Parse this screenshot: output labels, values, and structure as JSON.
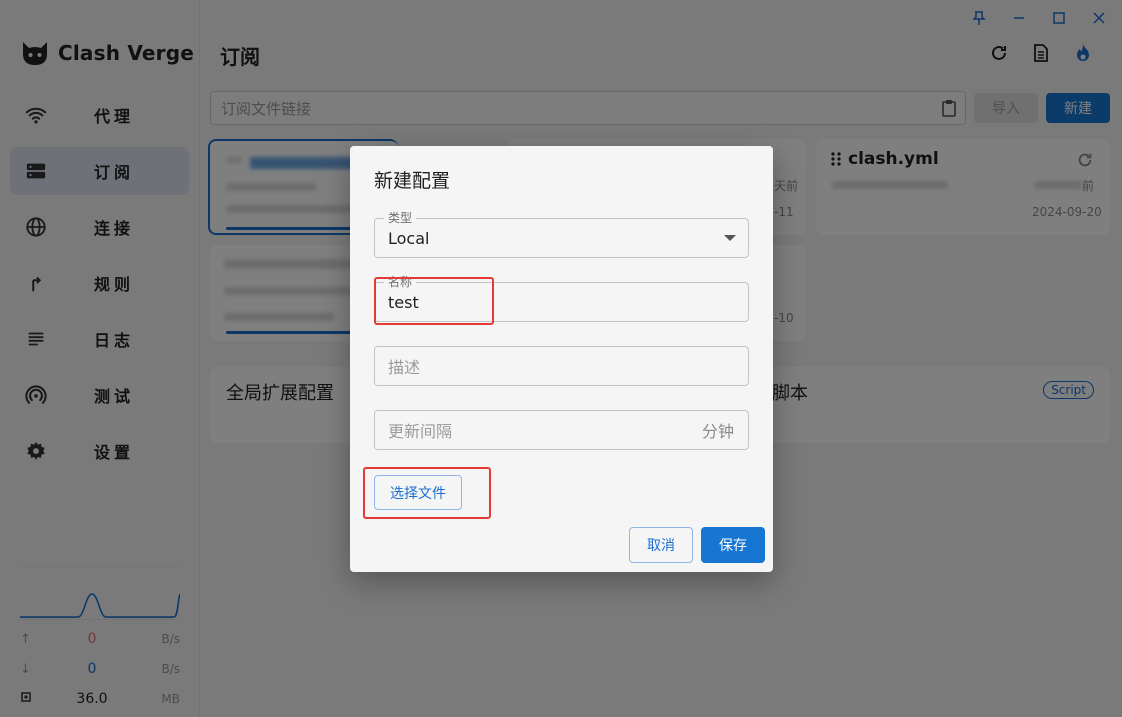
{
  "app": {
    "name": "Clash Verge"
  },
  "sidebar": {
    "items": [
      {
        "label": "代理",
        "icon": "wifi-icon"
      },
      {
        "label": "订阅",
        "icon": "server-icon",
        "active": true
      },
      {
        "label": "连接",
        "icon": "globe-icon"
      },
      {
        "label": "规则",
        "icon": "fork-arrow-icon"
      },
      {
        "label": "日志",
        "icon": "list-lines-icon"
      },
      {
        "label": "测试",
        "icon": "radar-icon"
      },
      {
        "label": "设置",
        "icon": "gear-icon"
      }
    ],
    "traffic": {
      "up_value": "0",
      "up_unit": "B/s",
      "down_value": "0",
      "down_unit": "B/s",
      "mem_value": "36.0",
      "mem_unit": "MB"
    }
  },
  "header": {
    "title": "订阅"
  },
  "toolbar": {
    "url_placeholder": "订阅文件链接",
    "import_label": "导入",
    "new_label": "新建"
  },
  "cards": {
    "clash_yml": {
      "title": "clash.yml",
      "date": "2024-09-20",
      "partial_time": "前"
    },
    "card2_partial_time": "天前",
    "card2_partial_date": "-11",
    "card4_partial_date": "-10"
  },
  "extensions": {
    "global_label": "全局扩展配置",
    "script_partial": "脚本",
    "script_badge": "Script"
  },
  "dialog": {
    "title": "新建配置",
    "type_legend": "类型",
    "type_value": "Local",
    "name_legend": "名称",
    "name_value": "test",
    "desc_placeholder": "描述",
    "interval_placeholder": "更新间隔",
    "interval_unit": "分钟",
    "choose_file_label": "选择文件",
    "cancel_label": "取消",
    "save_label": "保存"
  },
  "colors": {
    "accent": "#1676d2",
    "highlight": "#e53935"
  }
}
